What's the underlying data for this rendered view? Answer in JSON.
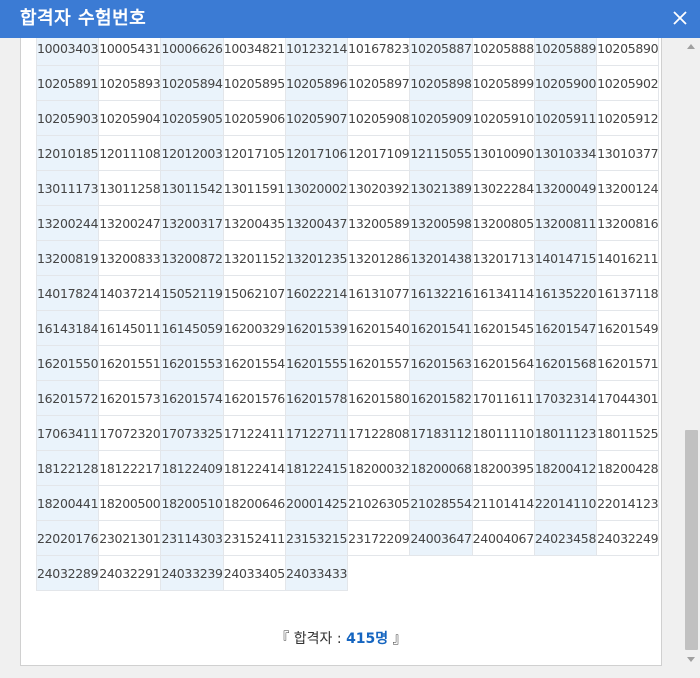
{
  "dialog": {
    "title": "합격자 수험번호",
    "close_icon": "close-icon"
  },
  "numbers": [
    [
      "10003403",
      "10005431",
      "10006626",
      "10034821",
      "10123214",
      "10167823",
      "10205887",
      "10205888",
      "10205889",
      "10205890"
    ],
    [
      "10205891",
      "10205893",
      "10205894",
      "10205895",
      "10205896",
      "10205897",
      "10205898",
      "10205899",
      "10205900",
      "10205902"
    ],
    [
      "10205903",
      "10205904",
      "10205905",
      "10205906",
      "10205907",
      "10205908",
      "10205909",
      "10205910",
      "10205911",
      "10205912"
    ],
    [
      "12010185",
      "12011108",
      "12012003",
      "12017105",
      "12017106",
      "12017109",
      "12115055",
      "13010090",
      "13010334",
      "13010377"
    ],
    [
      "13011173",
      "13011258",
      "13011542",
      "13011591",
      "13020002",
      "13020392",
      "13021389",
      "13022284",
      "13200049",
      "13200124"
    ],
    [
      "13200244",
      "13200247",
      "13200317",
      "13200435",
      "13200437",
      "13200589",
      "13200598",
      "13200805",
      "13200811",
      "13200816"
    ],
    [
      "13200819",
      "13200833",
      "13200872",
      "13201152",
      "13201235",
      "13201286",
      "13201438",
      "13201713",
      "14014715",
      "14016211"
    ],
    [
      "14017824",
      "14037214",
      "15052119",
      "15062107",
      "16022214",
      "16131077",
      "16132216",
      "16134114",
      "16135220",
      "16137118"
    ],
    [
      "16143184",
      "16145011",
      "16145059",
      "16200329",
      "16201539",
      "16201540",
      "16201541",
      "16201545",
      "16201547",
      "16201549"
    ],
    [
      "16201550",
      "16201551",
      "16201553",
      "16201554",
      "16201555",
      "16201557",
      "16201563",
      "16201564",
      "16201568",
      "16201571"
    ],
    [
      "16201572",
      "16201573",
      "16201574",
      "16201576",
      "16201578",
      "16201580",
      "16201582",
      "17011611",
      "17032314",
      "17044301"
    ],
    [
      "17063411",
      "17072320",
      "17073325",
      "17122411",
      "17122711",
      "17122808",
      "17183112",
      "18011110",
      "18011123",
      "18011525"
    ],
    [
      "18122128",
      "18122217",
      "18122409",
      "18122414",
      "18122415",
      "18200032",
      "18200068",
      "18200395",
      "18200412",
      "18200428"
    ],
    [
      "18200441",
      "18200500",
      "18200510",
      "18200646",
      "20001425",
      "21026305",
      "21028554",
      "21101414",
      "22014110",
      "22014123"
    ],
    [
      "22020176",
      "23021301",
      "23114303",
      "23152411",
      "23153215",
      "23172209",
      "24003647",
      "24004067",
      "24023458",
      "24032249"
    ],
    [
      "24032289",
      "24032291",
      "24033239",
      "24033405",
      "24033433"
    ]
  ],
  "footer": {
    "open_quote": "『",
    "label": "합격자 :",
    "count": "415",
    "unit": "명",
    "close_quote": "』"
  },
  "scroll": {
    "position_fraction": 0.62
  }
}
